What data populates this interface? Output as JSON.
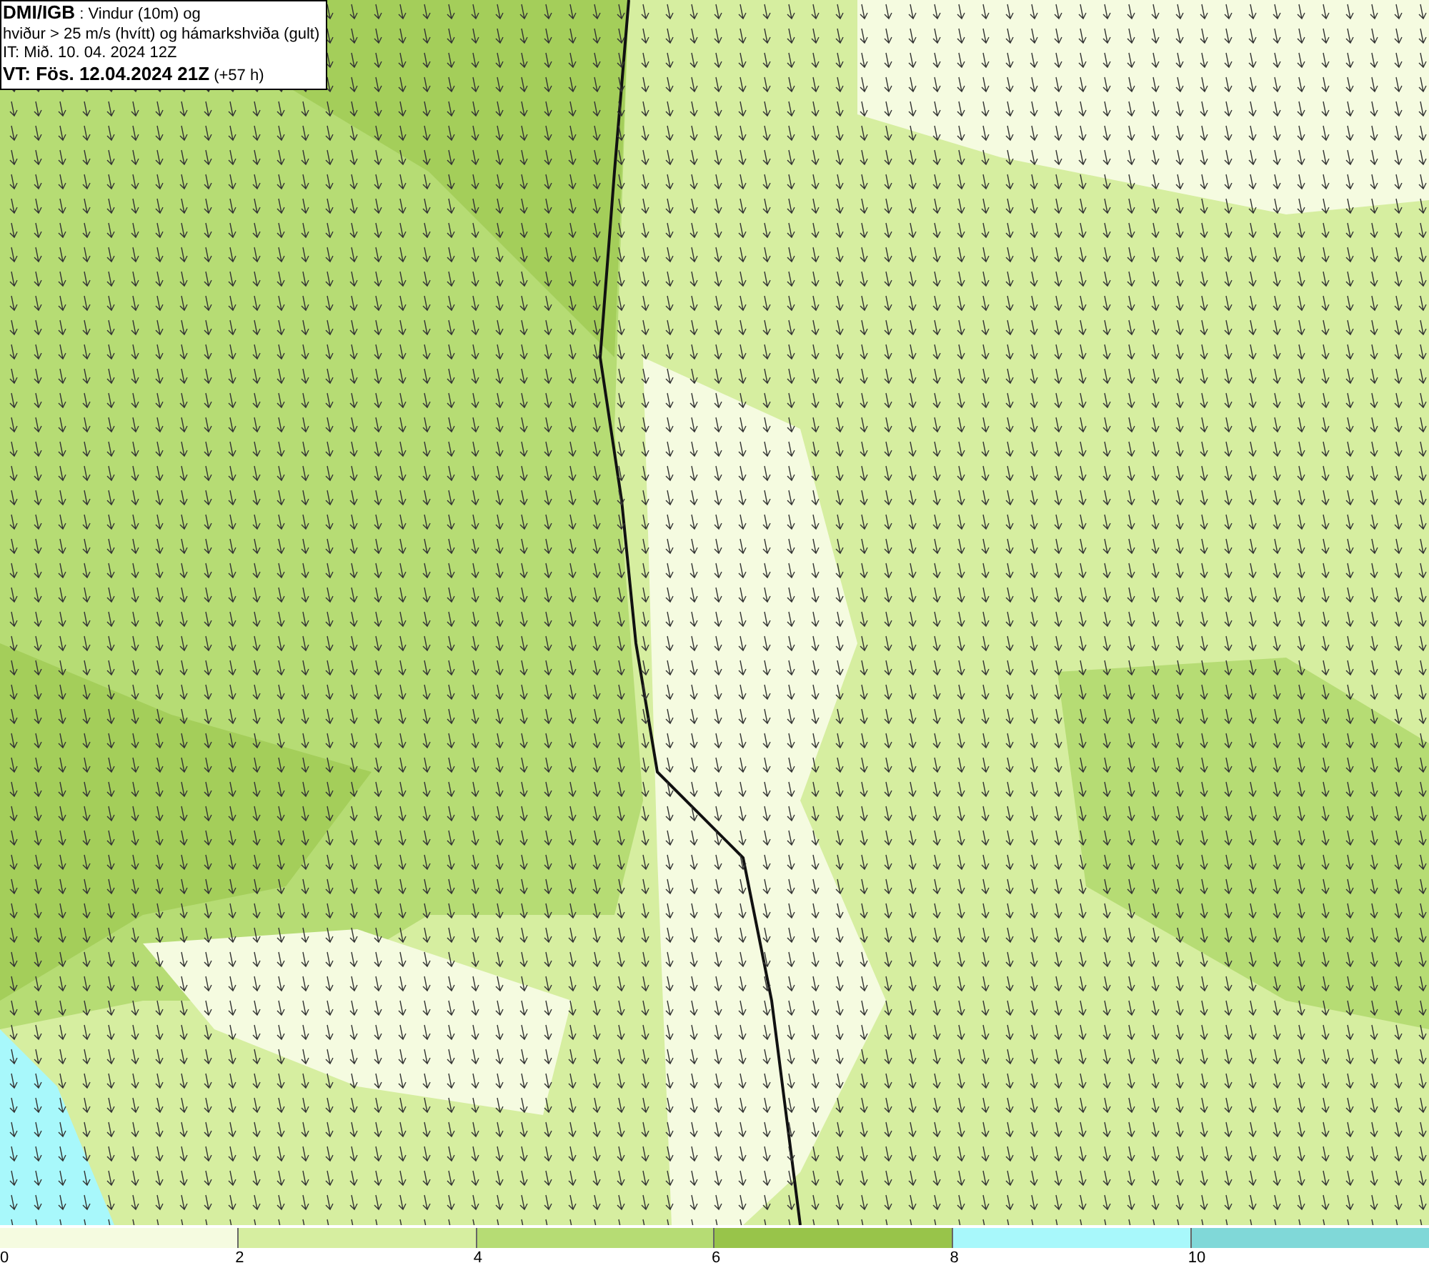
{
  "info_box": {
    "lines": [
      "**DMI/IGB** : Vindur (10m) og",
      "hviður > 25 m/s (hvítt) og hámarkshviða (gult)",
      "IT: Mið. 10. 04. 2024 12Z",
      "**VT: Fös. 12.04.2024 21Z** (+57 h)"
    ]
  },
  "legend": {
    "segments": [
      {
        "label": "0",
        "color": "#f5fbe0"
      },
      {
        "label": "2",
        "color": "#d6eea0"
      },
      {
        "label": "4",
        "color": "#b6dc74"
      },
      {
        "label": "6",
        "color": "#98c44a"
      },
      {
        "label": "8",
        "color": "#a8f8fb"
      },
      {
        "label": "10",
        "color": "#80d8d8"
      }
    ]
  }
}
